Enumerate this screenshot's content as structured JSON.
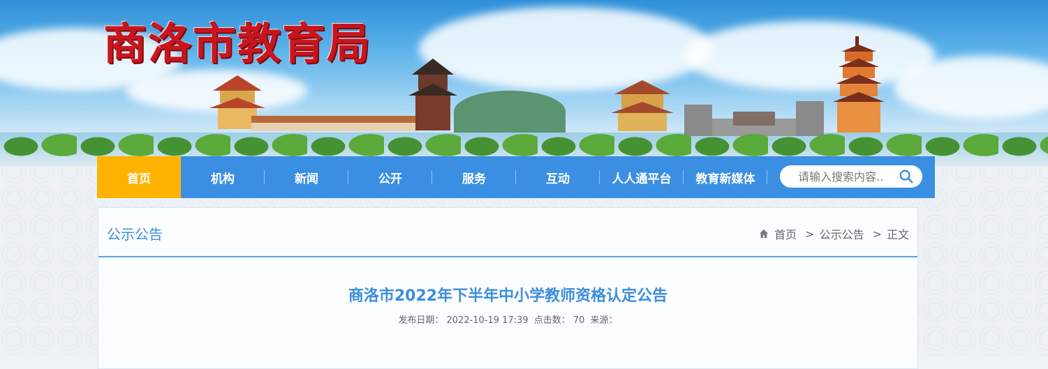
{
  "header": {
    "site_title": "商洛市教育局"
  },
  "nav": {
    "items": [
      {
        "label": "首页",
        "active": true
      },
      {
        "label": "机构"
      },
      {
        "label": "新闻"
      },
      {
        "label": "公开"
      },
      {
        "label": "服务"
      },
      {
        "label": "互动"
      },
      {
        "label": "人人通平台"
      },
      {
        "label": "教育新媒体"
      }
    ],
    "search_placeholder": "请输入搜索内容.."
  },
  "panel": {
    "title": "公示公告",
    "breadcrumb": {
      "home": "首页",
      "section": "公示公告",
      "current": "正文",
      "separator": ">"
    }
  },
  "article": {
    "title": "商洛市2022年下半年中小学教师资格认定公告",
    "publish_label": "发布日期：",
    "publish_date": "2022-10-19 17:39",
    "clicks_label": "点击数：",
    "clicks": "70",
    "source_label": "来源："
  },
  "colors": {
    "nav_bg": "#3b8fe3",
    "nav_active": "#ffb300",
    "title_red": "#c8161e",
    "accent_blue": "#3d8edb"
  }
}
